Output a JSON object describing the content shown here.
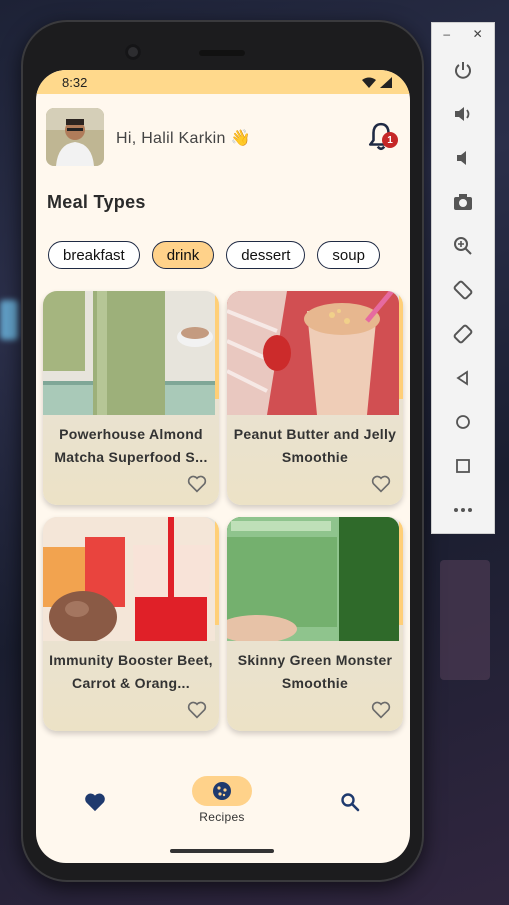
{
  "status_bar": {
    "time": "8:32"
  },
  "header": {
    "greeting": "Hi, Halil Karkin 👋",
    "notification_count": "1"
  },
  "section": {
    "title": "Meal Types"
  },
  "chips": [
    {
      "label": "breakfast",
      "active": false
    },
    {
      "label": "drink",
      "active": true
    },
    {
      "label": "dessert",
      "active": false
    },
    {
      "label": "soup",
      "active": false
    }
  ],
  "recipes": [
    {
      "title": "Powerhouse Almond Matcha Superfood S...",
      "image": "green-matcha-smoothie"
    },
    {
      "title": "Peanut Butter and Jelly Smoothie",
      "image": "peanut-butter-smoothie"
    },
    {
      "title": "Immunity Booster Beet, Carrot & Orang...",
      "image": "beet-juice"
    },
    {
      "title": "Skinny Green Monster Smoothie",
      "image": "green-smoothie-jar"
    }
  ],
  "bottom_nav": {
    "items": [
      {
        "icon": "heart-icon",
        "label": ""
      },
      {
        "icon": "cookie-icon",
        "label": "Recipes"
      },
      {
        "icon": "search-icon",
        "label": ""
      }
    ]
  },
  "emulator_controls": {
    "window": [
      "minimize-icon",
      "close-icon"
    ],
    "buttons": [
      "power-icon",
      "volume-up-icon",
      "volume-down-icon",
      "camera-icon",
      "zoom-icon",
      "rotate-left-icon",
      "rotate-right-icon",
      "back-icon",
      "home-icon",
      "overview-icon",
      "more-icon"
    ]
  },
  "colors": {
    "accent": "#ffd28a",
    "statusbar": "#ffd98c",
    "primary": "#1f3a6e",
    "badge": "#c62828",
    "background": "#fff8ee"
  }
}
